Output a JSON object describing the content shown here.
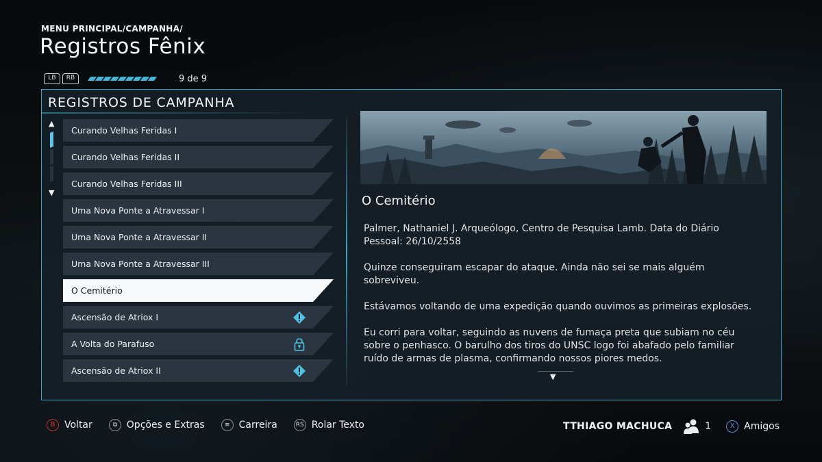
{
  "header": {
    "breadcrumb": "MENU PRINCIPAL/CAMPANHA/",
    "title": "Registros Fênix",
    "bumper_left": "LB",
    "bumper_right": "RB",
    "progress_segments": 9,
    "page_indicator": "9 de 9"
  },
  "panel": {
    "title": "REGISTROS DE CAMPANHA",
    "list": [
      {
        "label": "Curando Velhas Feridas I",
        "state": "normal",
        "badge": null
      },
      {
        "label": "Curando Velhas Feridas II",
        "state": "normal",
        "badge": null
      },
      {
        "label": "Curando Velhas Feridas III",
        "state": "normal",
        "badge": null
      },
      {
        "label": "Uma Nova Ponte a Atravessar I",
        "state": "normal",
        "badge": null
      },
      {
        "label": "Uma Nova Ponte a Atravessar II",
        "state": "normal",
        "badge": null
      },
      {
        "label": "Uma Nova Ponte a Atravessar III",
        "state": "normal",
        "badge": null
      },
      {
        "label": "O Cemitério",
        "state": "selected",
        "badge": null
      },
      {
        "label": "Ascensão de Atriox I",
        "state": "normal",
        "badge": "new-diamond-icon"
      },
      {
        "label": "A Volta do Parafuso",
        "state": "normal",
        "badge": "lock-icon"
      },
      {
        "label": "Ascensão de Atriox II",
        "state": "normal",
        "badge": "new-diamond-icon"
      }
    ]
  },
  "entry": {
    "title": "O Cemitério",
    "paragraphs": [
      "Palmer, Nathaniel J. Arqueólogo, Centro de Pesquisa Lamb. Data do Diário Pessoal: 26/10/2558",
      "Quinze conseguiram escapar do ataque. Ainda não sei se mais alguém sobreviveu.",
      "Estávamos voltando de uma expedição quando ouvimos as primeiras explosões.",
      "Eu corri para voltar, seguindo as nuvens de fumaça preta que subiam no céu sobre o penhasco. O barulho dos tiros do UNSC logo foi abafado pelo familiar ruído de armas de plasma, confirmando nossos piores medos."
    ]
  },
  "footer": {
    "hints": [
      {
        "glyph": "B",
        "label": "Voltar",
        "icon": "b-button-icon"
      },
      {
        "glyph": "⧉",
        "label": "Opções e Extras",
        "icon": "view-button-icon"
      },
      {
        "glyph": "≡",
        "label": "Carreira",
        "icon": "menu-button-icon"
      },
      {
        "glyph": "RS",
        "label": "Rolar Texto",
        "icon": "right-stick-icon"
      }
    ],
    "gamertag": "TTHIAGO MACHUCA",
    "friends_online": "1",
    "friends_glyph": "X",
    "friends_label": "Amigos"
  },
  "colors": {
    "accent": "#3aa9cc",
    "progress": "#46b6d8",
    "selected_bg": "#f7f8f9",
    "item_bg": "#2a3540",
    "b_button": "#e23b3b",
    "x_button": "#5f8fe0"
  }
}
